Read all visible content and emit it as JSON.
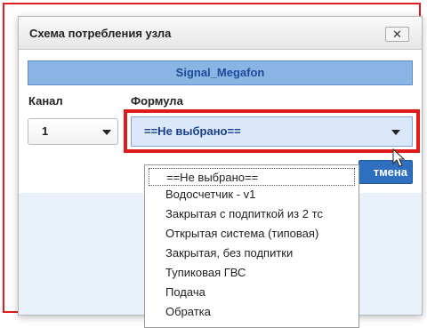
{
  "dialog": {
    "title": "Схема потребления узла",
    "close_label": "✕",
    "node_name": "Signal_Megafon",
    "channel_label": "Канал",
    "formula_label": "Формула",
    "channel_value": "1",
    "formula_value": "==Не выбрано==",
    "cancel_label": "тмена"
  },
  "formula_options": [
    "==Не выбрано==",
    "Водосчетчик - v1",
    "Закрытая с подпиткой из 2 тс",
    "Открытая система (типовая)",
    "Закрытая, без подпитки",
    "Тупиковая ГВС",
    "Подача",
    "Обратка"
  ],
  "colors": {
    "highlight": "#e01b1b",
    "banner_bg": "#8ab4e4",
    "banner_text": "#1c4b99",
    "button_bg": "#2f6fc0"
  },
  "icons": {
    "close": "close-icon",
    "channel_dropdown": "chevron-down-icon",
    "formula_dropdown": "chevron-down-icon",
    "pointer": "mouse-pointer-icon"
  }
}
